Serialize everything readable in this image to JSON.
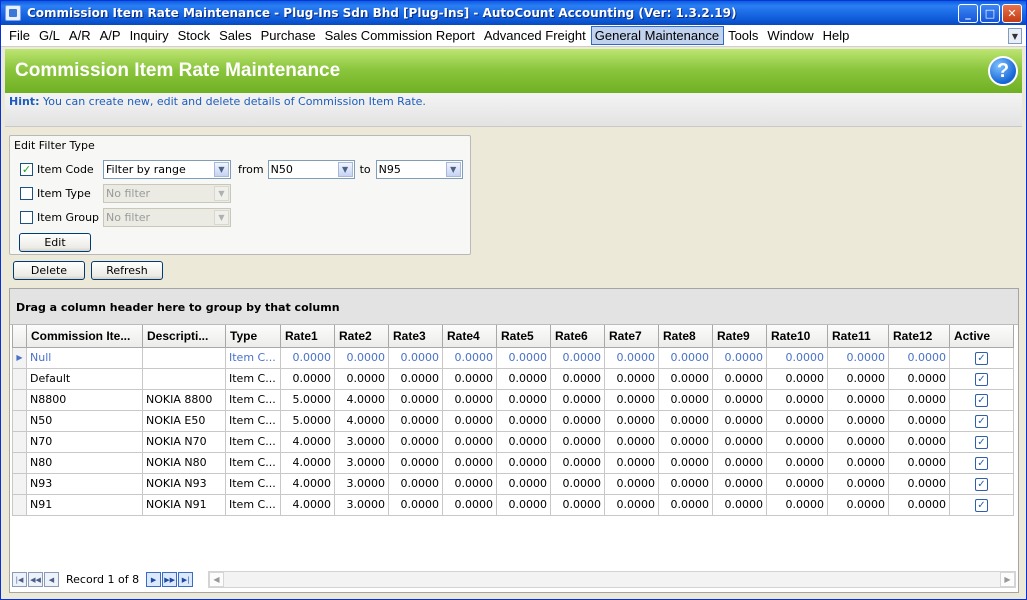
{
  "window": {
    "title": "Commission Item Rate Maintenance - Plug-Ins Sdn Bhd [Plug-Ins] - AutoCount Accounting (Ver: 1.3.2.19)"
  },
  "menu": [
    "File",
    "G/L",
    "A/R",
    "A/P",
    "Inquiry",
    "Stock",
    "Sales",
    "Purchase",
    "Sales Commission Report",
    "Advanced Freight",
    "General Maintenance",
    "Tools",
    "Window",
    "Help"
  ],
  "menu_active": "General Maintenance",
  "banner": {
    "title": "Commission Item Rate Maintenance",
    "help_icon": "?"
  },
  "hint": {
    "label": "Hint:",
    "text": "You can create new, edit and delete details of Commission Item Rate."
  },
  "filter": {
    "legend": "Edit Filter Type",
    "item_code": {
      "label": "Item Code",
      "checked": true,
      "mode": "Filter by range",
      "from_label": "from",
      "from": "N50",
      "to_label": "to",
      "to": "N95"
    },
    "item_type": {
      "label": "Item Type",
      "checked": false,
      "mode": "No filter"
    },
    "item_group": {
      "label": "Item Group",
      "checked": false,
      "mode": "No filter"
    },
    "edit_label": "Edit"
  },
  "actions": {
    "delete_label": "Delete",
    "refresh_label": "Refresh"
  },
  "grid": {
    "group_hint": "Drag a column header here to group by that column",
    "columns": [
      "Commission Ite...",
      "Descripti...",
      "Type",
      "Rate1",
      "Rate2",
      "Rate3",
      "Rate4",
      "Rate5",
      "Rate6",
      "Rate7",
      "Rate8",
      "Rate9",
      "Rate10",
      "Rate11",
      "Rate12",
      "Active"
    ],
    "rows": [
      [
        "Null",
        "",
        "Item C...",
        "0.0000",
        "0.0000",
        "0.0000",
        "0.0000",
        "0.0000",
        "0.0000",
        "0.0000",
        "0.0000",
        "0.0000",
        "0.0000",
        "0.0000",
        "0.0000",
        "✓"
      ],
      [
        "Default",
        "",
        "Item C...",
        "0.0000",
        "0.0000",
        "0.0000",
        "0.0000",
        "0.0000",
        "0.0000",
        "0.0000",
        "0.0000",
        "0.0000",
        "0.0000",
        "0.0000",
        "0.0000",
        "✓"
      ],
      [
        "N8800",
        "NOKIA 8800",
        "Item C...",
        "5.0000",
        "4.0000",
        "0.0000",
        "0.0000",
        "0.0000",
        "0.0000",
        "0.0000",
        "0.0000",
        "0.0000",
        "0.0000",
        "0.0000",
        "0.0000",
        "✓"
      ],
      [
        "N50",
        "NOKIA E50",
        "Item C...",
        "5.0000",
        "4.0000",
        "0.0000",
        "0.0000",
        "0.0000",
        "0.0000",
        "0.0000",
        "0.0000",
        "0.0000",
        "0.0000",
        "0.0000",
        "0.0000",
        "✓"
      ],
      [
        "N70",
        "NOKIA N70",
        "Item C...",
        "4.0000",
        "3.0000",
        "0.0000",
        "0.0000",
        "0.0000",
        "0.0000",
        "0.0000",
        "0.0000",
        "0.0000",
        "0.0000",
        "0.0000",
        "0.0000",
        "✓"
      ],
      [
        "N80",
        "NOKIA N80",
        "Item C...",
        "4.0000",
        "3.0000",
        "0.0000",
        "0.0000",
        "0.0000",
        "0.0000",
        "0.0000",
        "0.0000",
        "0.0000",
        "0.0000",
        "0.0000",
        "0.0000",
        "✓"
      ],
      [
        "N93",
        "NOKIA N93",
        "Item C...",
        "4.0000",
        "3.0000",
        "0.0000",
        "0.0000",
        "0.0000",
        "0.0000",
        "0.0000",
        "0.0000",
        "0.0000",
        "0.0000",
        "0.0000",
        "0.0000",
        "✓"
      ],
      [
        "N91",
        "NOKIA N91",
        "Item C...",
        "4.0000",
        "3.0000",
        "0.0000",
        "0.0000",
        "0.0000",
        "0.0000",
        "0.0000",
        "0.0000",
        "0.0000",
        "0.0000",
        "0.0000",
        "0.0000",
        "✓"
      ]
    ],
    "selected_row": 0,
    "record_text": "Record 1 of 8"
  },
  "colors": {
    "banner": "#8cc63e",
    "titlebar": "#0c58d6",
    "hint": "#1d5dbd",
    "selected_text": "#4a72c9"
  }
}
